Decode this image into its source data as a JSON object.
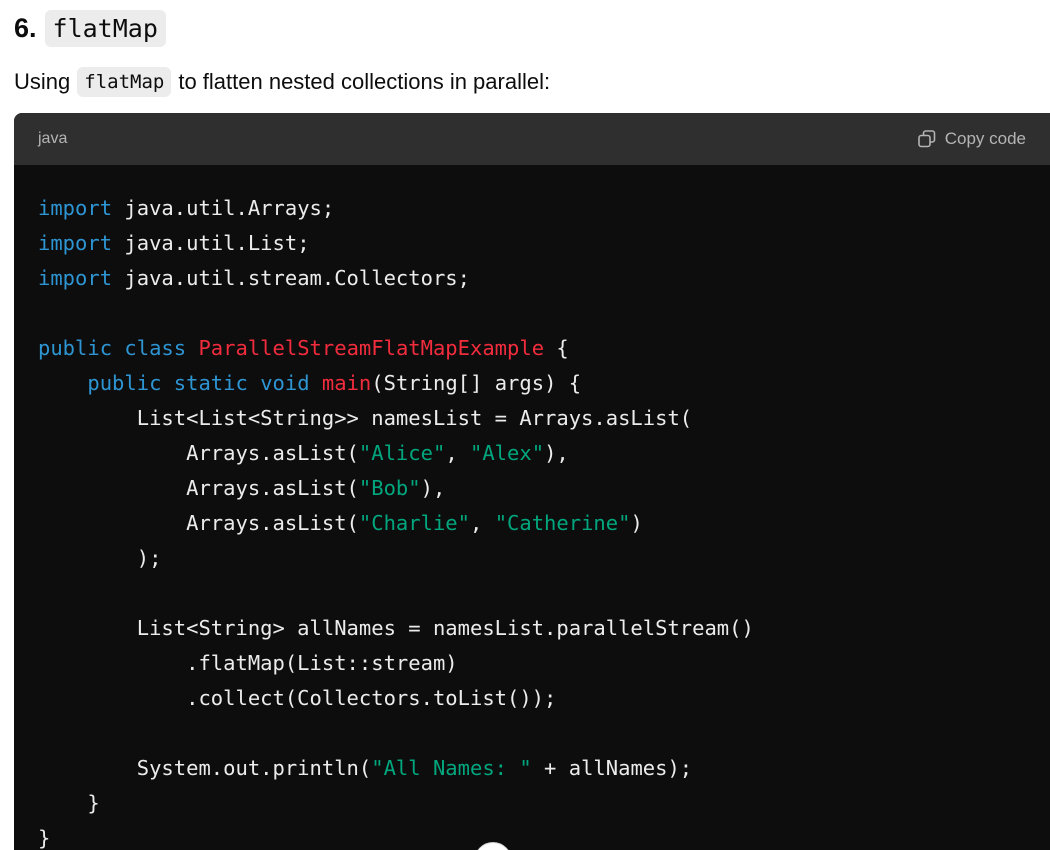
{
  "heading": {
    "number": "6.",
    "code": "flatMap"
  },
  "paragraph": {
    "before": "Using",
    "code": "flatMap",
    "after": "to flatten nested collections in parallel:"
  },
  "code_block": {
    "language": "java",
    "copy_label": "Copy code",
    "copy_icon": "copy-icon",
    "lines": [
      [
        {
          "t": "kw",
          "s": "import"
        },
        {
          "t": "pl",
          "s": " java.util.Arrays;"
        }
      ],
      [
        {
          "t": "kw",
          "s": "import"
        },
        {
          "t": "pl",
          "s": " java.util.List;"
        }
      ],
      [
        {
          "t": "kw",
          "s": "import"
        },
        {
          "t": "pl",
          "s": " java.util.stream.Collectors;"
        }
      ],
      [],
      [
        {
          "t": "kw",
          "s": "public"
        },
        {
          "t": "pl",
          "s": " "
        },
        {
          "t": "kw",
          "s": "class"
        },
        {
          "t": "pl",
          "s": " "
        },
        {
          "t": "cls",
          "s": "ParallelStreamFlatMapExample"
        },
        {
          "t": "pl",
          "s": " {"
        }
      ],
      [
        {
          "t": "pl",
          "s": "    "
        },
        {
          "t": "kw",
          "s": "public"
        },
        {
          "t": "pl",
          "s": " "
        },
        {
          "t": "kw",
          "s": "static"
        },
        {
          "t": "pl",
          "s": " "
        },
        {
          "t": "kw",
          "s": "void"
        },
        {
          "t": "pl",
          "s": " "
        },
        {
          "t": "cls",
          "s": "main"
        },
        {
          "t": "pl",
          "s": "(String[] args) {"
        }
      ],
      [
        {
          "t": "pl",
          "s": "        List<List<String>> namesList = Arrays.asList("
        }
      ],
      [
        {
          "t": "pl",
          "s": "            Arrays.asList("
        },
        {
          "t": "str",
          "s": "\"Alice\""
        },
        {
          "t": "pl",
          "s": ", "
        },
        {
          "t": "str",
          "s": "\"Alex\""
        },
        {
          "t": "pl",
          "s": "),"
        }
      ],
      [
        {
          "t": "pl",
          "s": "            Arrays.asList("
        },
        {
          "t": "str",
          "s": "\"Bob\""
        },
        {
          "t": "pl",
          "s": "),"
        }
      ],
      [
        {
          "t": "pl",
          "s": "            Arrays.asList("
        },
        {
          "t": "str",
          "s": "\"Charlie\""
        },
        {
          "t": "pl",
          "s": ", "
        },
        {
          "t": "str",
          "s": "\"Catherine\""
        },
        {
          "t": "pl",
          "s": ")"
        }
      ],
      [
        {
          "t": "pl",
          "s": "        );"
        }
      ],
      [],
      [
        {
          "t": "pl",
          "s": "        List<String> allNames = namesList.parallelStream()"
        }
      ],
      [
        {
          "t": "pl",
          "s": "            .flatMap(List::stream)"
        }
      ],
      [
        {
          "t": "pl",
          "s": "            .collect(Collectors.toList());"
        }
      ],
      [],
      [
        {
          "t": "pl",
          "s": "        System.out.println("
        },
        {
          "t": "str",
          "s": "\"All Names: \""
        },
        {
          "t": "pl",
          "s": " + allNames);"
        }
      ],
      [
        {
          "t": "pl",
          "s": "    }"
        }
      ],
      [
        {
          "t": "pl",
          "s": "}"
        }
      ]
    ]
  }
}
